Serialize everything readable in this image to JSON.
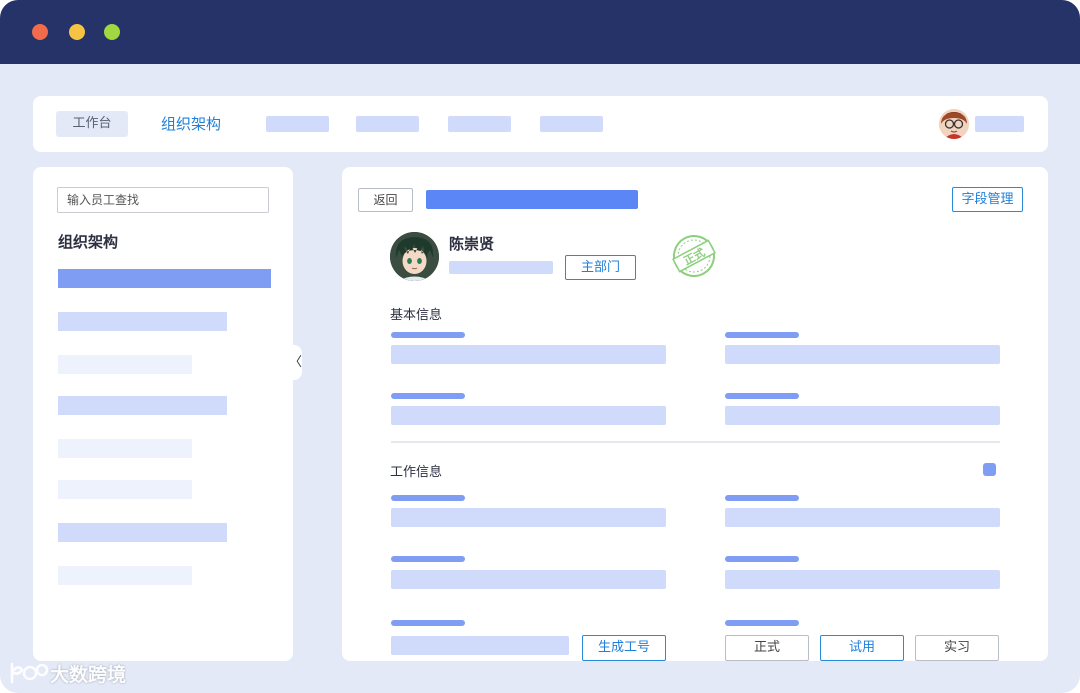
{
  "window": {
    "controls": [
      "close",
      "minimize",
      "zoom"
    ]
  },
  "topnav": {
    "workbench_label": "工作台",
    "active_label": "组织架构"
  },
  "sidebar": {
    "search_placeholder": "输入员工查找",
    "title": "组织架构",
    "collapse_glyph": "〈"
  },
  "main": {
    "back_label": "返回",
    "field_manage_label": "字段管理",
    "employee": {
      "name": "陈崇贤",
      "primary_dept_label": "主部门",
      "stamp_text": "正式"
    },
    "basic_info_title": "基本信息",
    "work_info_title": "工作信息",
    "generate_id_label": "生成工号",
    "status_options": [
      "正式",
      "试用",
      "实习"
    ],
    "selected_status": "试用"
  },
  "watermark": {
    "text": "大数跨境"
  },
  "colors": {
    "titlebar": "#263369",
    "background": "#e3e9f7",
    "accent": "#1f7fd9",
    "placeholder": "#d0dafb",
    "highlight": "#5b86f5",
    "stamp": "#8ccf7e"
  }
}
